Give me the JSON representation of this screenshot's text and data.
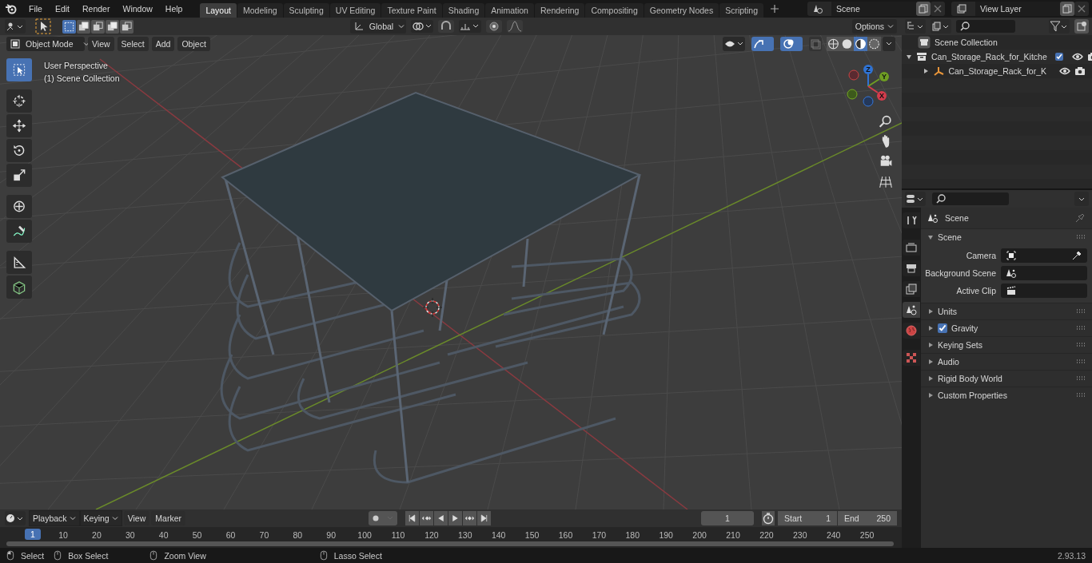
{
  "top_bar": {
    "menus": [
      "File",
      "Edit",
      "Render",
      "Window",
      "Help"
    ],
    "workspaces": [
      {
        "label": "Layout",
        "selected": true
      },
      {
        "label": "Modeling",
        "selected": false
      },
      {
        "label": "Sculpting",
        "selected": false
      },
      {
        "label": "UV Editing",
        "selected": false
      },
      {
        "label": "Texture Paint",
        "selected": false
      },
      {
        "label": "Shading",
        "selected": false
      },
      {
        "label": "Animation",
        "selected": false
      },
      {
        "label": "Rendering",
        "selected": false
      },
      {
        "label": "Compositing",
        "selected": false
      },
      {
        "label": "Geometry Nodes",
        "selected": false
      },
      {
        "label": "Scripting",
        "selected": false
      }
    ],
    "scene": "Scene",
    "view_layer": "View Layer"
  },
  "viewport": {
    "transform_orientation": "Global",
    "options": "Options",
    "mode": "Object Mode",
    "menus": [
      "View",
      "Select",
      "Add",
      "Object"
    ],
    "select_modes": [
      {
        "selected": true
      },
      {
        "selected": false
      },
      {
        "selected": false
      },
      {
        "selected": false
      },
      {
        "selected": false
      }
    ],
    "shading_modes": [
      {
        "selected": false
      },
      {
        "selected": false
      },
      {
        "selected": true
      },
      {
        "selected": false
      }
    ],
    "info": [
      "User Perspective",
      "(1) Scene Collection"
    ],
    "gizmo_axes": [
      "Z",
      "Y",
      "X"
    ],
    "tools": [
      {
        "kind": "select",
        "selected": true
      },
      {
        "kind": "cursor",
        "selected": false
      },
      {
        "kind": "move",
        "selected": false
      },
      {
        "kind": "rotate",
        "selected": false
      },
      {
        "kind": "scale",
        "selected": false
      },
      {
        "kind": "transform",
        "selected": false
      },
      {
        "kind": "annotate",
        "selected": false
      },
      {
        "kind": "measure",
        "selected": false
      },
      {
        "kind": "add-cube",
        "selected": false
      }
    ]
  },
  "outliner": {
    "root": "Scene Collection",
    "children": [
      {
        "kind": "collection",
        "label": "Can_Storage_Rack_for_Kitche",
        "expanded": true,
        "checked": true,
        "children": [
          {
            "kind": "object",
            "label": "Can_Storage_Rack_for_K",
            "expanded": false
          }
        ]
      }
    ]
  },
  "properties": {
    "tabs": [
      {
        "kind": "tool",
        "selected": false
      },
      {
        "kind": "render",
        "selected": false
      },
      {
        "kind": "output",
        "selected": false
      },
      {
        "kind": "view-layer",
        "selected": false
      },
      {
        "kind": "scene",
        "selected": true
      },
      {
        "kind": "world",
        "selected": false
      },
      {
        "kind": "texture",
        "selected": false
      }
    ],
    "context": "Scene",
    "panels": [
      {
        "title": "Scene",
        "expanded": true,
        "fields": [
          {
            "label": "Camera",
            "kind": "camera"
          },
          {
            "label": "Background Scene",
            "kind": "scene"
          },
          {
            "label": "Active Clip",
            "kind": "clip"
          }
        ]
      },
      {
        "title": "Units",
        "expanded": false
      },
      {
        "title": "Gravity",
        "expanded": false,
        "checked": true
      },
      {
        "title": "Keying Sets",
        "expanded": false
      },
      {
        "title": "Audio",
        "expanded": false
      },
      {
        "title": "Rigid Body World",
        "expanded": false
      },
      {
        "title": "Custom Properties",
        "expanded": false
      }
    ]
  },
  "timeline": {
    "menus": [
      {
        "label": "Playback",
        "dropdown": true
      },
      {
        "label": "Keying",
        "dropdown": true
      },
      {
        "label": "View",
        "dropdown": false
      },
      {
        "label": "Marker",
        "dropdown": false
      }
    ],
    "current_frame": "1",
    "start_label": "Start",
    "start": "1",
    "end_label": "End",
    "end": "250",
    "ruler": [
      "1",
      "10",
      "20",
      "30",
      "40",
      "50",
      "60",
      "70",
      "80",
      "90",
      "100",
      "110",
      "120",
      "130",
      "140",
      "150",
      "160",
      "170",
      "180",
      "190",
      "200",
      "210",
      "220",
      "230",
      "240",
      "250"
    ]
  },
  "status_bar": {
    "hints": [
      "Select",
      "Box Select",
      "Zoom View",
      "Lasso Select"
    ],
    "version": "2.93.13"
  }
}
